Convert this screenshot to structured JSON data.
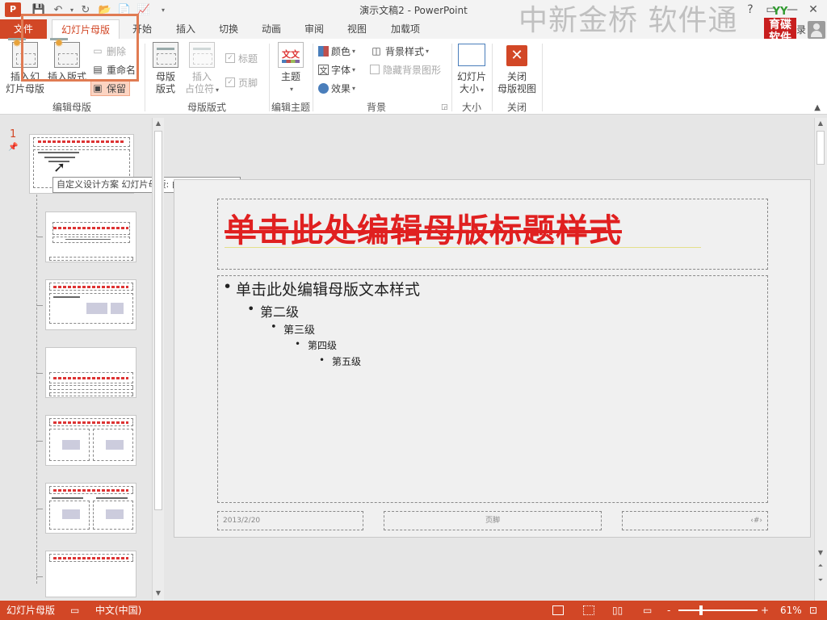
{
  "window": {
    "title": "演示文稿2 - PowerPoint",
    "app_icon_letter": "P",
    "watermark": "中新金桥 软件通",
    "logo_text": "育碟软件",
    "logo_leaves": "YY",
    "qat": {
      "save": "save-icon",
      "undo": "undo-icon",
      "redo": "redo-icon",
      "open": "folder-icon",
      "new": "new-file-icon",
      "present": "present-icon",
      "more": "▾"
    },
    "controls": {
      "help": "?",
      "restore": "▭",
      "minimize": "—",
      "close": "✕"
    },
    "partial_char": "录"
  },
  "tabs": [
    {
      "label": "文件"
    },
    {
      "label": "幻灯片母版"
    },
    {
      "label": "开始"
    },
    {
      "label": "插入"
    },
    {
      "label": "切换"
    },
    {
      "label": "动画"
    },
    {
      "label": "审阅"
    },
    {
      "label": "视图"
    },
    {
      "label": "加载项"
    }
  ],
  "ribbon": {
    "groups": {
      "edit_master": "编辑母版",
      "master_layout": "母版版式",
      "edit_theme": "编辑主题",
      "background": "背景",
      "size": "大小",
      "close": "关闭"
    },
    "insert_slide_master": [
      "插入幻",
      "灯片母版"
    ],
    "insert_layout": "插入版式",
    "delete": "删除",
    "rename": "重命名",
    "preserve": "保留",
    "master_layout_btn": [
      "母版",
      "版式"
    ],
    "insert_placeholder": [
      "插入",
      "占位符"
    ],
    "title_chk": "标题",
    "footer_chk": "页脚",
    "theme_btn": "主题",
    "theme_icon_text": "文文",
    "colors": "颜色",
    "fonts": "字体",
    "effects": "效果",
    "bg_styles": "背景样式",
    "hide_bg": "隐藏背景图形",
    "slide_size": [
      "幻灯片",
      "大小"
    ],
    "close_master": [
      "关闭",
      "母版视图"
    ]
  },
  "thumbpane": {
    "slide_number": "1",
    "tooltip": "自定义设计方案 幻灯片母版: 由幻灯片 1 使用"
  },
  "slide": {
    "title": "单击此处编辑母版标题样式",
    "levels": [
      "单击此处编辑母版文本样式",
      "第二级",
      "第三级",
      "第四级",
      "第五级"
    ],
    "date": "2013/2/20",
    "footer": "页脚",
    "page_num": "‹#›"
  },
  "statusbar": {
    "mode": "幻灯片母版",
    "language": "中文(中国)",
    "zoom": "61%",
    "zoom_minus": "-",
    "zoom_plus": "+"
  },
  "colors": {
    "accent": "#d24726",
    "title_red": "#e02020"
  }
}
